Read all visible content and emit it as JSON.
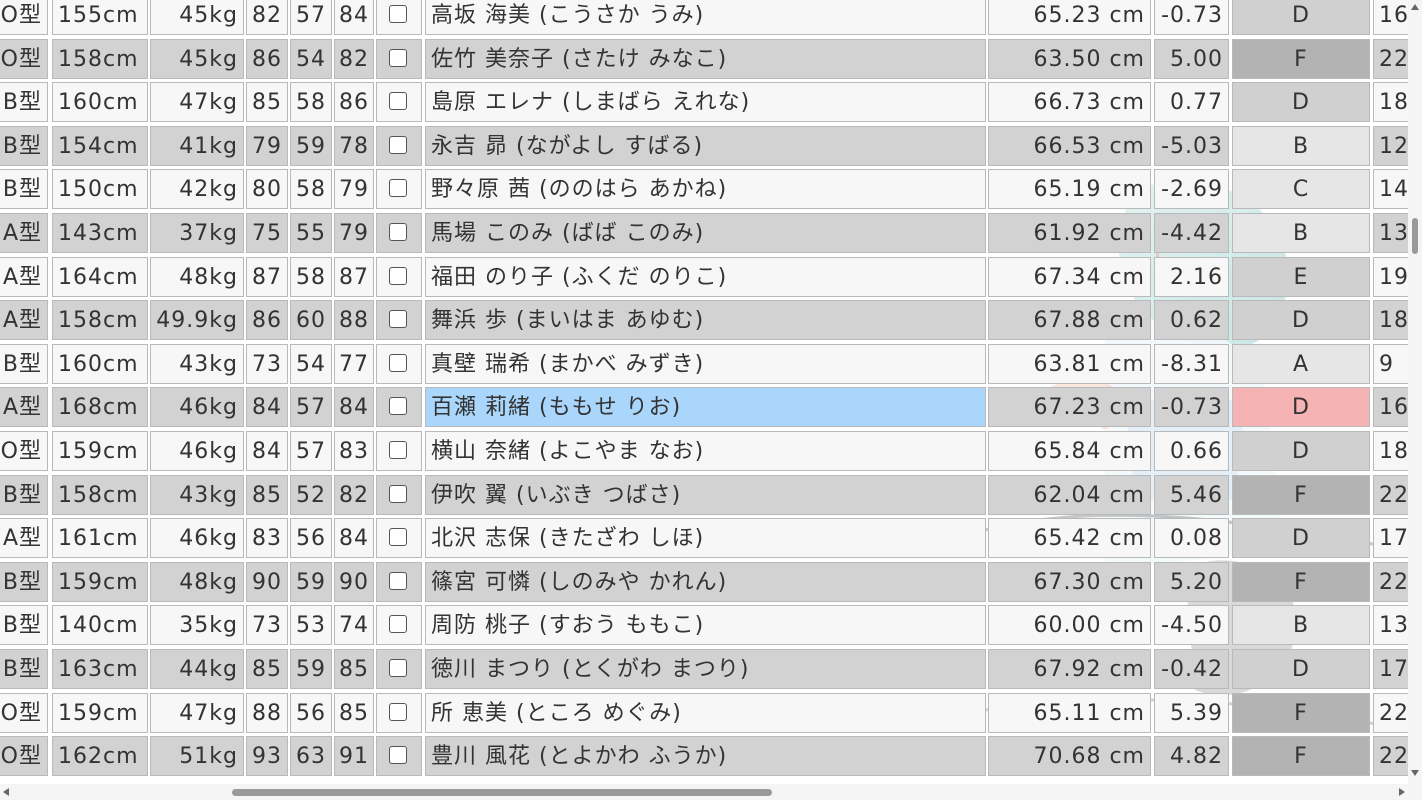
{
  "table": {
    "rows": [
      {
        "blood": "O型",
        "height": "155cm",
        "weight": "45kg",
        "b": "82",
        "w": "57",
        "h": "84",
        "name": "高坂 海美 (こうさか うみ)",
        "measure": "65.23 cm",
        "diff": "-0.73",
        "grade": "D",
        "last": "16"
      },
      {
        "blood": "O型",
        "height": "158cm",
        "weight": "45kg",
        "b": "86",
        "w": "54",
        "h": "82",
        "name": "佐竹 美奈子 (さたけ みなこ)",
        "measure": "63.50 cm",
        "diff": "5.00",
        "grade": "F",
        "last": "22"
      },
      {
        "blood": "B型",
        "height": "160cm",
        "weight": "47kg",
        "b": "85",
        "w": "58",
        "h": "86",
        "name": "島原 エレナ (しまばら えれな)",
        "measure": "66.73 cm",
        "diff": "0.77",
        "grade": "D",
        "last": "18"
      },
      {
        "blood": "B型",
        "height": "154cm",
        "weight": "41kg",
        "b": "79",
        "w": "59",
        "h": "78",
        "name": "永吉 昴 (ながよし すばる)",
        "measure": "66.53 cm",
        "diff": "-5.03",
        "grade": "B",
        "last": "12"
      },
      {
        "blood": "B型",
        "height": "150cm",
        "weight": "42kg",
        "b": "80",
        "w": "58",
        "h": "79",
        "name": "野々原 茜 (ののはら あかね)",
        "measure": "65.19 cm",
        "diff": "-2.69",
        "grade": "C",
        "last": "14"
      },
      {
        "blood": "A型",
        "height": "143cm",
        "weight": "37kg",
        "b": "75",
        "w": "55",
        "h": "79",
        "name": "馬場 このみ (ばば このみ)",
        "measure": "61.92 cm",
        "diff": "-4.42",
        "grade": "B",
        "last": "13"
      },
      {
        "blood": "A型",
        "height": "164cm",
        "weight": "48kg",
        "b": "87",
        "w": "58",
        "h": "87",
        "name": "福田 のり子 (ふくだ のりこ)",
        "measure": "67.34 cm",
        "diff": "2.16",
        "grade": "E",
        "last": "19"
      },
      {
        "blood": "A型",
        "height": "158cm",
        "weight": "49.9kg",
        "b": "86",
        "w": "60",
        "h": "88",
        "name": "舞浜 歩 (まいはま あゆむ)",
        "measure": "67.88 cm",
        "diff": "0.62",
        "grade": "D",
        "last": "18"
      },
      {
        "blood": "B型",
        "height": "160cm",
        "weight": "43kg",
        "b": "73",
        "w": "54",
        "h": "77",
        "name": "真壁 瑞希 (まかべ みずき)",
        "measure": "63.81 cm",
        "diff": "-8.31",
        "grade": "A",
        "last": "9"
      },
      {
        "blood": "A型",
        "height": "168cm",
        "weight": "46kg",
        "b": "84",
        "w": "57",
        "h": "84",
        "name": "百瀬 莉緒 (ももせ りお)",
        "measure": "67.23 cm",
        "diff": "-0.73",
        "grade": "D",
        "last": "16",
        "selected": true
      },
      {
        "blood": "O型",
        "height": "159cm",
        "weight": "46kg",
        "b": "84",
        "w": "57",
        "h": "83",
        "name": "横山 奈緒 (よこやま なお)",
        "measure": "65.84 cm",
        "diff": "0.66",
        "grade": "D",
        "last": "18"
      },
      {
        "blood": "B型",
        "height": "158cm",
        "weight": "43kg",
        "b": "85",
        "w": "52",
        "h": "82",
        "name": "伊吹 翼 (いぶき つばさ)",
        "measure": "62.04 cm",
        "diff": "5.46",
        "grade": "F",
        "last": "22"
      },
      {
        "blood": "A型",
        "height": "161cm",
        "weight": "46kg",
        "b": "83",
        "w": "56",
        "h": "84",
        "name": "北沢 志保 (きたざわ しほ)",
        "measure": "65.42 cm",
        "diff": "0.08",
        "grade": "D",
        "last": "17"
      },
      {
        "blood": "B型",
        "height": "159cm",
        "weight": "48kg",
        "b": "90",
        "w": "59",
        "h": "90",
        "name": "篠宮 可憐 (しのみや かれん)",
        "measure": "67.30 cm",
        "diff": "5.20",
        "grade": "F",
        "last": "22"
      },
      {
        "blood": "B型",
        "height": "140cm",
        "weight": "35kg",
        "b": "73",
        "w": "53",
        "h": "74",
        "name": "周防 桃子 (すおう ももこ)",
        "measure": "60.00 cm",
        "diff": "-4.50",
        "grade": "B",
        "last": "13"
      },
      {
        "blood": "B型",
        "height": "163cm",
        "weight": "44kg",
        "b": "85",
        "w": "59",
        "h": "85",
        "name": "徳川 まつり (とくがわ まつり)",
        "measure": "67.92 cm",
        "diff": "-0.42",
        "grade": "D",
        "last": "17"
      },
      {
        "blood": "O型",
        "height": "159cm",
        "weight": "47kg",
        "b": "88",
        "w": "56",
        "h": "85",
        "name": "所 恵美 (ところ めぐみ)",
        "measure": "65.11 cm",
        "diff": "5.39",
        "grade": "F",
        "last": "22"
      },
      {
        "blood": "O型",
        "height": "162cm",
        "weight": "51kg",
        "b": "93",
        "w": "63",
        "h": "91",
        "name": "豊川 風花 (とよかわ ふうか)",
        "measure": "70.68 cm",
        "diff": "4.82",
        "grade": "F",
        "last": "22"
      }
    ]
  },
  "colors": {
    "selected_name_bg": "#aad6fb",
    "selected_grade_bg": "#f6b3b3"
  },
  "icons": {
    "scroll_up": "triangle-up-icon",
    "scroll_down": "triangle-down-icon",
    "scroll_left": "triangle-left-icon",
    "scroll_right": "triangle-right-icon"
  }
}
